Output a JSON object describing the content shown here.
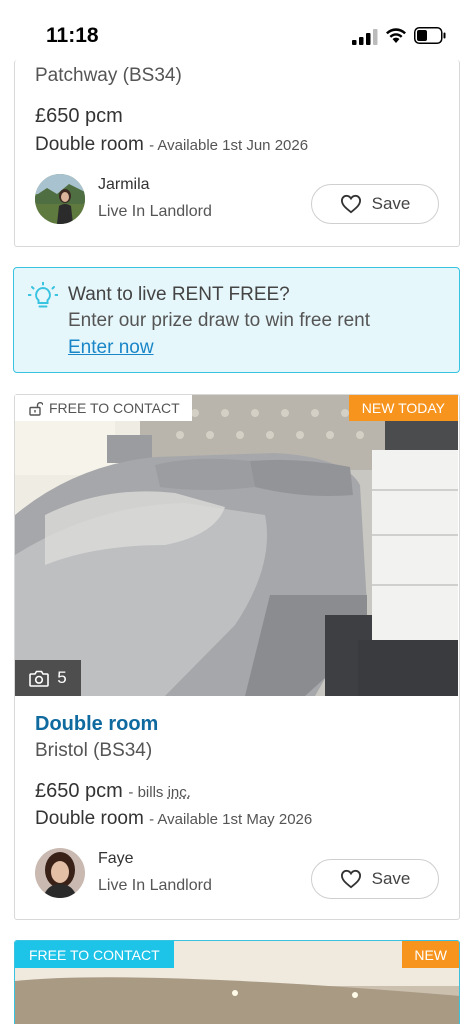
{
  "status_bar": {
    "time": "11:18",
    "icons": [
      "signal-icon",
      "wifi-icon",
      "battery-icon"
    ]
  },
  "listing1": {
    "location": "Patchway (BS34)",
    "price": "£650 pcm",
    "room_type": "Double room",
    "availability": "- Available 1st Jun 2026",
    "advertiser_name": "Jarmila",
    "advertiser_role": "Live In Landlord",
    "save_label": "Save"
  },
  "promo": {
    "icon": "lightbulb-icon",
    "title": "Want to live RENT FREE?",
    "text": "Enter our prize draw to win free rent",
    "link": "Enter now"
  },
  "listing2": {
    "badge_contact": "FREE TO CONTACT",
    "badge_new": "NEW TODAY",
    "photo_count": "5",
    "title": "Double room",
    "location": "Bristol (BS34)",
    "price": "£650 pcm",
    "bills_prefix": "- bills ",
    "bills_inc": "inc.",
    "room_type": "Double room",
    "availability": "- Available 1st May 2026",
    "advertiser_name": "Faye",
    "advertiser_role": "Live In Landlord",
    "save_label": "Save"
  },
  "listing3": {
    "badge_contact": "FREE TO CONTACT",
    "badge_new": "NEW"
  },
  "colors": {
    "accent_blue": "#1ec3e8",
    "link_blue": "#1a86c8",
    "title_blue": "#0f6a9f",
    "badge_orange": "#f7941d"
  }
}
